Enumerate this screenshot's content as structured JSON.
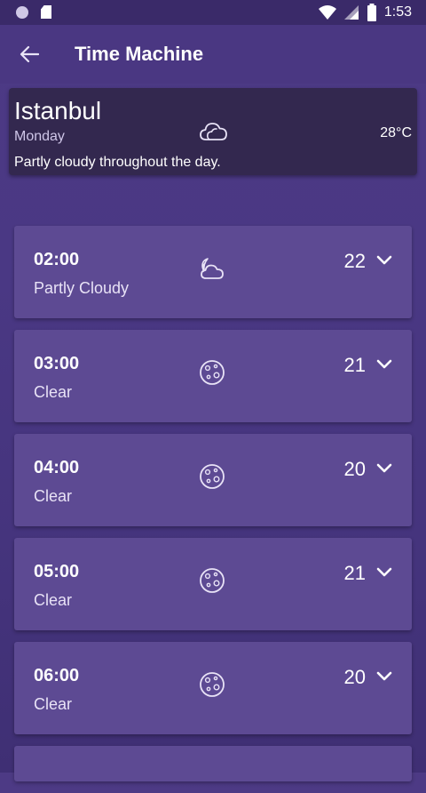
{
  "status_bar": {
    "time": "1:53"
  },
  "app_bar": {
    "title": "Time Machine"
  },
  "summary": {
    "city": "Istanbul",
    "day": "Monday",
    "temperature": "28°C",
    "description": "Partly cloudy throughout the day.",
    "icon": "cloud-icon"
  },
  "hours": [
    {
      "time": "02:00",
      "condition": "Partly Cloudy",
      "temp": "22",
      "icon": "partly-cloudy-night-icon"
    },
    {
      "time": "03:00",
      "condition": "Clear",
      "temp": "21",
      "icon": "moon-icon"
    },
    {
      "time": "04:00",
      "condition": "Clear",
      "temp": "20",
      "icon": "moon-icon"
    },
    {
      "time": "05:00",
      "condition": "Clear",
      "temp": "21",
      "icon": "moon-icon"
    },
    {
      "time": "06:00",
      "condition": "Clear",
      "temp": "20",
      "icon": "moon-icon"
    }
  ],
  "colors": {
    "app_bar": "#4a3782",
    "summary_card": "#33284f",
    "hour_card": "#5d4a93"
  }
}
